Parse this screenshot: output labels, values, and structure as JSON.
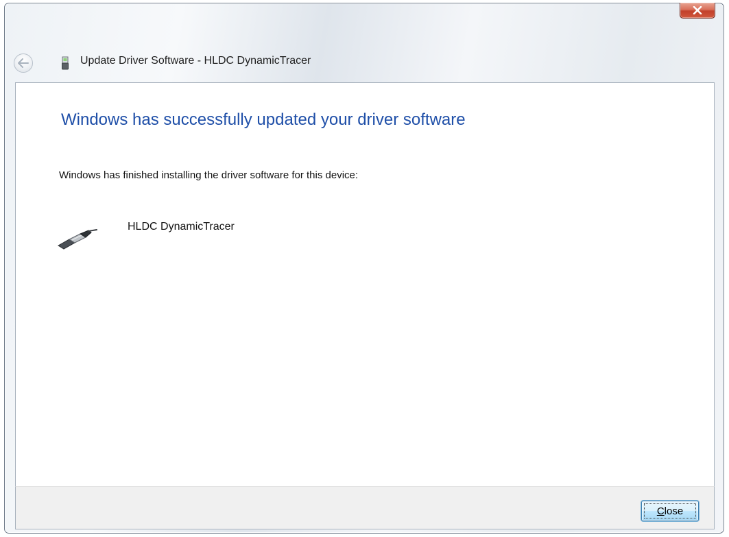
{
  "window": {
    "title": "Update Driver Software - HLDC DynamicTracer"
  },
  "main": {
    "heading": "Windows has successfully updated your driver software",
    "message": "Windows has finished installing the driver software for this device:",
    "device_name": "HLDC DynamicTracer"
  },
  "footer": {
    "close_label": "Close"
  },
  "icons": {
    "back": "back-arrow-icon",
    "device": "usb-device-icon",
    "usb": "usb-cable-icon",
    "close": "close-x-icon"
  },
  "colors": {
    "heading": "#1f4fa8",
    "close_button_red": "#c2412b",
    "footer_bg": "#f0f0f0"
  }
}
